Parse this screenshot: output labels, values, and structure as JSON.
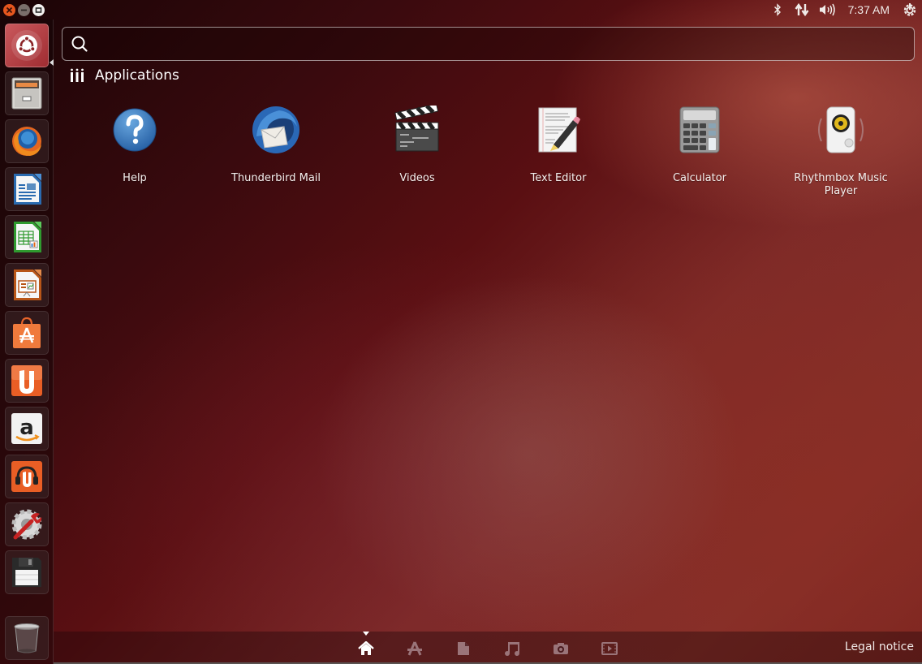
{
  "window_controls": {
    "close": "×",
    "minimize": "–",
    "maximize": "□"
  },
  "panel": {
    "indicators": [
      {
        "name": "bluetooth-icon",
        "glyph": "✱"
      },
      {
        "name": "network-icon",
        "glyph": "⇅"
      },
      {
        "name": "volume-icon",
        "glyph": "🔊"
      },
      {
        "name": "power-icon",
        "glyph": "⏻"
      }
    ],
    "clock": "7:37 AM"
  },
  "launcher": {
    "items": [
      {
        "name": "dash-home",
        "icon": "ubuntu-logo-icon",
        "active": true
      },
      {
        "name": "files",
        "icon": "file-cabinet-icon"
      },
      {
        "name": "firefox",
        "icon": "firefox-icon"
      },
      {
        "name": "libreoffice-writer",
        "icon": "writer-document-icon"
      },
      {
        "name": "libreoffice-calc",
        "icon": "calc-spreadsheet-icon"
      },
      {
        "name": "libreoffice-impress",
        "icon": "impress-presentation-icon"
      },
      {
        "name": "ubuntu-software-center",
        "icon": "shopping-bag-icon"
      },
      {
        "name": "ubuntu-one",
        "icon": "ubuntu-one-icon"
      },
      {
        "name": "amazon",
        "icon": "amazon-icon"
      },
      {
        "name": "ubuntu-one-music",
        "icon": "ubuntu-one-music-icon"
      },
      {
        "name": "system-settings",
        "icon": "settings-wrench-icon"
      },
      {
        "name": "floppy-drive",
        "icon": "floppy-disk-icon"
      },
      {
        "name": "trash",
        "icon": "trash-icon"
      }
    ]
  },
  "search": {
    "value": "",
    "placeholder": ""
  },
  "category": {
    "title": "Applications"
  },
  "apps": [
    {
      "label": "Help",
      "icon": "help-question-icon"
    },
    {
      "label": "Thunderbird Mail",
      "icon": "thunderbird-icon"
    },
    {
      "label": "Videos",
      "icon": "clapperboard-icon"
    },
    {
      "label": "Text Editor",
      "icon": "text-editor-icon"
    },
    {
      "label": "Calculator",
      "icon": "calculator-icon"
    },
    {
      "label": "Rhythmbox Music Player",
      "icon": "speaker-icon"
    }
  ],
  "lenses": [
    {
      "name": "home",
      "icon": "home-icon",
      "active": true
    },
    {
      "name": "applications",
      "icon": "applications-lens-icon"
    },
    {
      "name": "files",
      "icon": "file-icon"
    },
    {
      "name": "music",
      "icon": "music-note-icon"
    },
    {
      "name": "photos",
      "icon": "camera-icon"
    },
    {
      "name": "videos",
      "icon": "video-icon"
    }
  ],
  "legal_notice": "Legal notice",
  "colors": {
    "accent": "#e5561e",
    "launcher_active": "#b0383c"
  }
}
